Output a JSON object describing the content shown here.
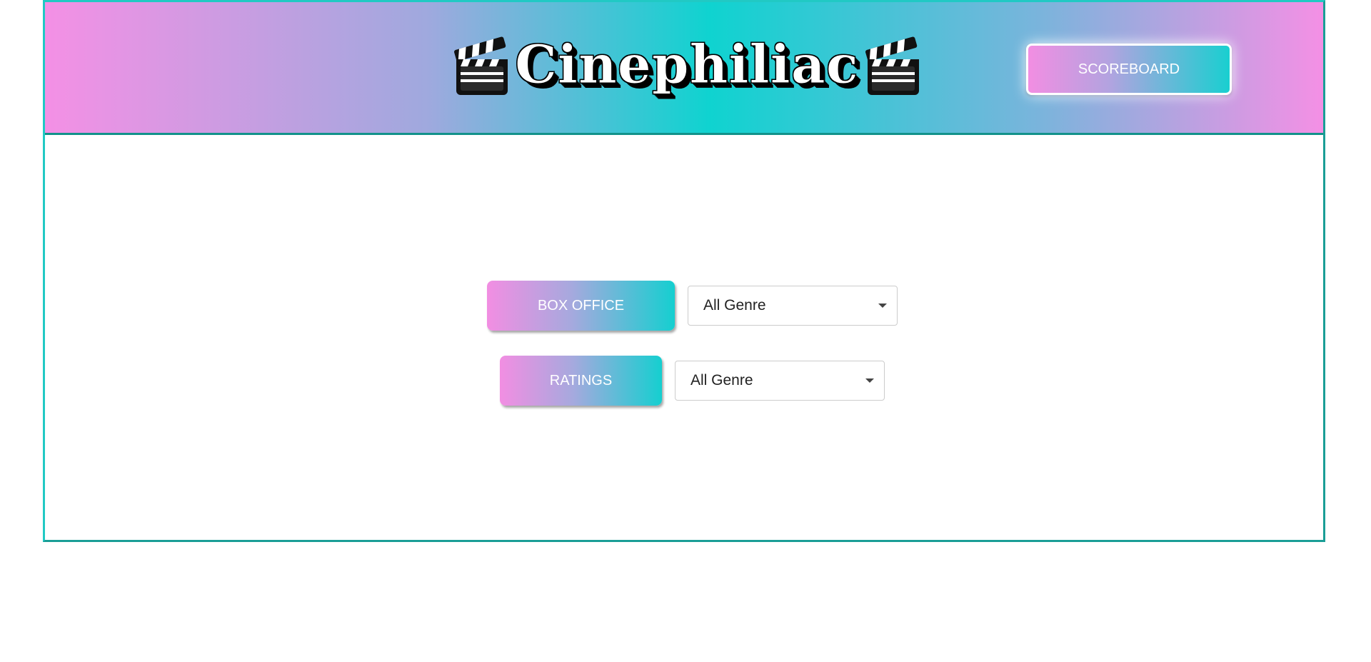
{
  "header": {
    "title": "Cinephiliac",
    "scoreboard_label": "SCOREBOARD"
  },
  "controls": {
    "box_office": {
      "label": "BOX OFFICE",
      "genre_selected": "All Genre"
    },
    "ratings": {
      "label": "RATINGS",
      "genre_selected": "All Genre"
    }
  },
  "icons": {
    "left": "clapperboard-icon",
    "right": "clapperboard-icon"
  },
  "colors": {
    "pink": "#f490e5",
    "teal": "#0fd3d0",
    "border": "#1a9e96"
  }
}
